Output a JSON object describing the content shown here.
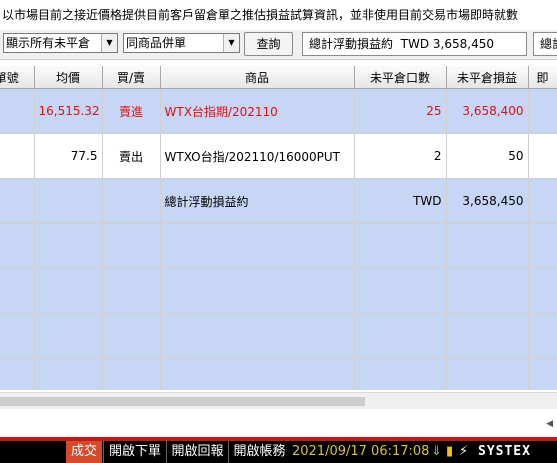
{
  "notice": "以市場目前之接近價格提供目前客戶留倉單之推估損益試算資訊，並非使用目前交易市場即時就數",
  "filters": {
    "position_filter": "顯示所有未平倉",
    "merge_filter": "同商品併單",
    "query_button": "查詢",
    "summary_label": "總計浮動損益約",
    "summary_value": "TWD 3,658,450",
    "summary2_label": "總計"
  },
  "table": {
    "columns": [
      "單號",
      "均價",
      "買/賣",
      "商品",
      "未平倉口數",
      "未平倉損益",
      "即"
    ],
    "rows": [
      {
        "order_no": "",
        "avg_price": "16,515.32",
        "side": "賣進",
        "product": "WTX台指期/202110",
        "open_qty": "25",
        "pnl": "3,658,400",
        "highlight": true,
        "color": "#e01010"
      },
      {
        "order_no": "",
        "avg_price": "77.5",
        "side": "賣出",
        "product": "WTXO台指/202110/16000PUT",
        "open_qty": "2",
        "pnl": "50",
        "highlight": false,
        "color": "#000000"
      }
    ],
    "total": {
      "label": "總計浮動損益約",
      "currency": "TWD",
      "value": "3,658,450"
    }
  },
  "statusbar": {
    "tabs": [
      "成交",
      "開啟下單",
      "開啟回報",
      "開啟帳務"
    ],
    "datetime": "2021/09/17 06:17:08",
    "brand": "SYSTEX"
  }
}
